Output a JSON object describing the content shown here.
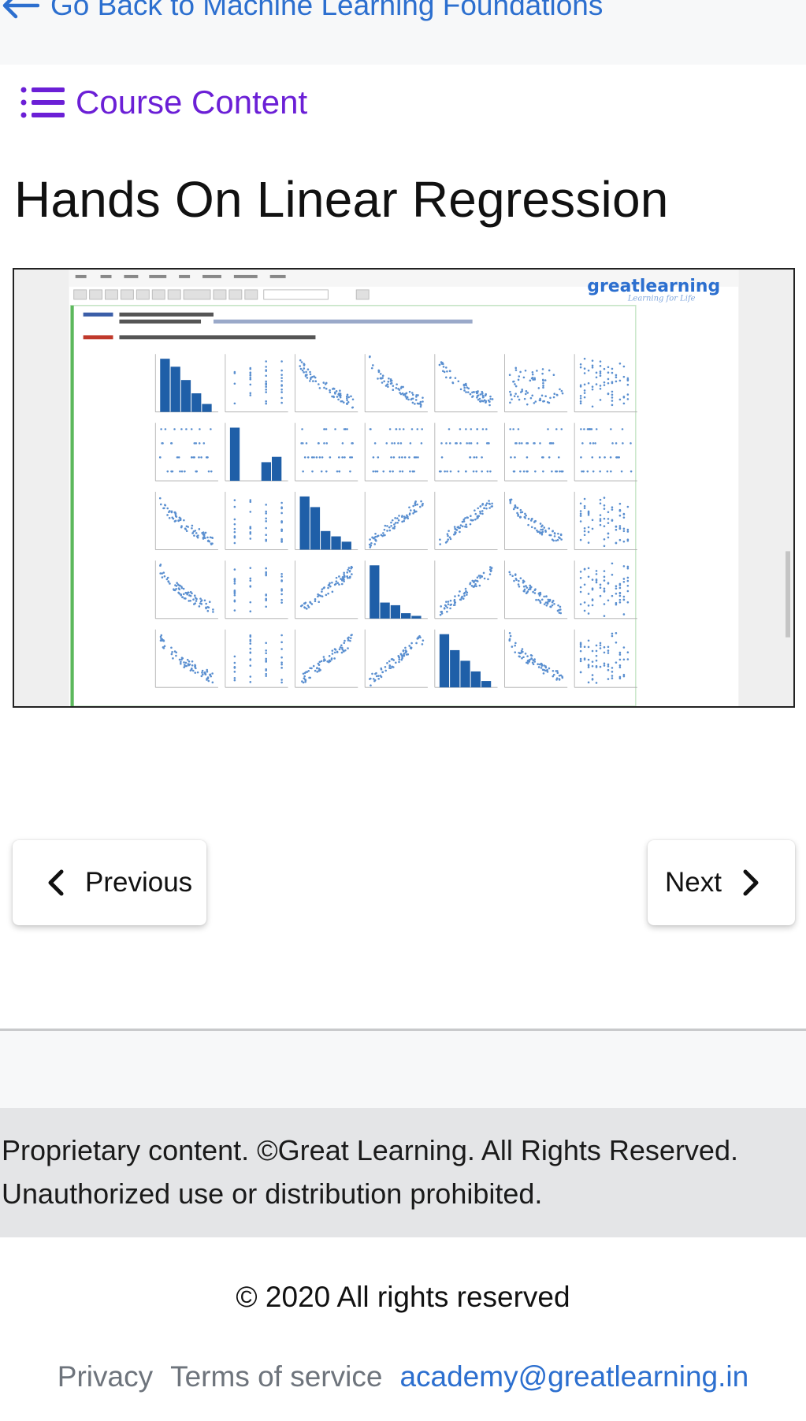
{
  "header": {
    "back_label": "Go Back to Machine Learning Foundations"
  },
  "course_content_label": "Course Content",
  "lesson": {
    "title": "Hands On Linear Regression"
  },
  "video": {
    "brand_text": "greatlearning",
    "brand_tagline": "Learning for Life"
  },
  "navigation": {
    "previous_label": "Previous",
    "next_label": "Next"
  },
  "notice": {
    "line1": "Proprietary content. ©Great Learning. All Rights Reserved.",
    "line2": "Unauthorized use or distribution prohibited."
  },
  "footer": {
    "copyright": "© 2020 All rights reserved",
    "privacy": "Privacy",
    "terms": "Terms of service",
    "email": "academy@greatlearning.in"
  },
  "colors": {
    "link_blue": "#2c6fcf",
    "course_purple": "#6b1fd6",
    "plot_blue": "#1f5fa8",
    "notebook_green": "#5cb85c"
  }
}
